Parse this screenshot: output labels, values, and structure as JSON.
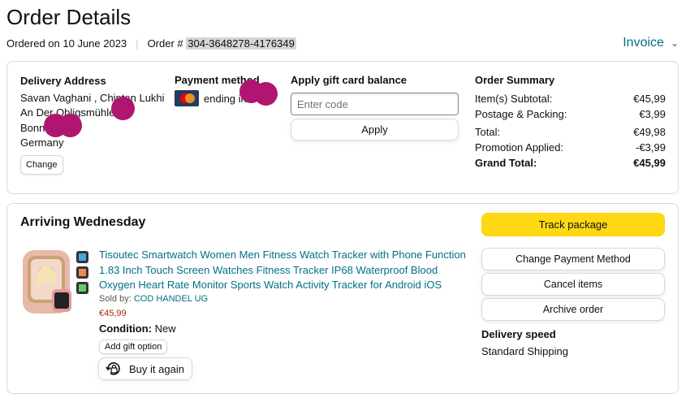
{
  "page": {
    "title": "Order Details",
    "ordered_on": "Ordered on 10 June 2023",
    "order_prefix": "Order #",
    "order_number": "304-3648278-4176349",
    "invoice_label": "Invoice",
    "separator": "|"
  },
  "delivery": {
    "title": "Delivery Address",
    "lines": [
      "Savan Vaghani , Chintan Lukhi",
      "An Der Obligsmühle",
      "Bonn",
      "Germany"
    ],
    "change_label": "Change"
  },
  "payment": {
    "title": "Payment method",
    "card_brand_icon": "mastercard-icon",
    "ending_text": "ending in"
  },
  "gift_card": {
    "title": "Apply gift card balance",
    "placeholder": "Enter code",
    "apply_label": "Apply"
  },
  "summary": {
    "title": "Order Summary",
    "subtotal_label": "Item(s) Subtotal:",
    "subtotal_value": "€45,99",
    "postage_label": "Postage & Packing:",
    "postage_value": "€3,99",
    "total_label": "Total:",
    "total_value": "€49,98",
    "promo_label": "Promotion Applied:",
    "promo_value": "-€3,99",
    "grand_label": "Grand Total:",
    "grand_value": "€45,99"
  },
  "shipment": {
    "heading": "Arriving Wednesday",
    "product_title": "Tisoutec Smartwatch Women Men Fitness Watch Tracker with Phone Function 1.83 Inch Touch Screen Watches Fitness Tracker IP68 Waterproof Blood Oxygen Heart Rate Monitor Sports Watch Activity Tracker for Android iOS",
    "sold_by_label": "Sold by:",
    "seller": "COD HANDEL UG",
    "price": "€45,99",
    "condition_label": "Condition:",
    "condition_value": "New",
    "gift_option_label": "Add gift option",
    "buy_again_label": "Buy it again"
  },
  "actions": {
    "track_label": "Track package",
    "change_payment_label": "Change Payment Method",
    "cancel_label": "Cancel items",
    "archive_label": "Archive order",
    "delivery_speed_title": "Delivery speed",
    "delivery_speed_value": "Standard Shipping"
  },
  "colors": {
    "link": "#007185",
    "track_button": "#ffd814",
    "price": "#b12704",
    "redaction": "#b01572"
  }
}
